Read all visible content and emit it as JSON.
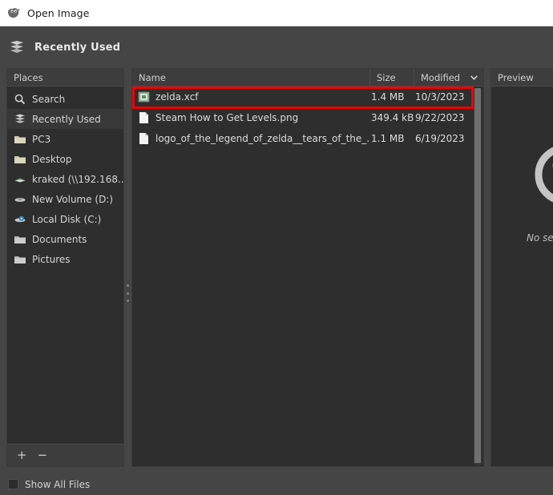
{
  "window": {
    "title": "Open Image",
    "icon": "wilber-icon"
  },
  "location_bar": {
    "icon": "recent-stack-icon",
    "title": "Recently Used"
  },
  "sidebar": {
    "header": "Places",
    "items": [
      {
        "label": "Search",
        "icon": "search-icon",
        "selected": false
      },
      {
        "label": "Recently Used",
        "icon": "recent-stack-icon",
        "selected": true
      },
      {
        "label": "PC3",
        "icon": "folder-icon",
        "selected": false
      },
      {
        "label": "Desktop",
        "icon": "folder-icon",
        "selected": false
      },
      {
        "label": "kraked (\\\\192.168....",
        "icon": "network-drive-icon",
        "selected": false
      },
      {
        "label": "New Volume (D:)",
        "icon": "drive-icon",
        "selected": false
      },
      {
        "label": "Local Disk (C:)",
        "icon": "disk-icon",
        "selected": false
      },
      {
        "label": "Documents",
        "icon": "folder-gray-icon",
        "selected": false
      },
      {
        "label": "Pictures",
        "icon": "folder-gray-icon",
        "selected": false
      }
    ],
    "add_button": "+",
    "remove_button": "−"
  },
  "file_list": {
    "columns": {
      "name": "Name",
      "size": "Size",
      "modified": "Modified",
      "sort_icon": "chevron-down-icon"
    },
    "rows": [
      {
        "name": "zelda.xcf",
        "size": "1.4 MB",
        "modified": "10/3/2023",
        "icon": "xcf-file-icon",
        "highlighted": true
      },
      {
        "name": "Steam How to Get Levels.png",
        "size": "349.4 kB",
        "modified": "9/22/2023",
        "icon": "image-file-icon",
        "highlighted": false
      },
      {
        "name": "logo_of_the_legend_of_zelda__tears_of_the_...",
        "size": "1.1 MB",
        "modified": "6/19/2023",
        "icon": "image-file-icon",
        "highlighted": false
      }
    ]
  },
  "preview": {
    "header": "Preview",
    "icon": "question-mark-icon",
    "empty_text": "No selection"
  },
  "footer": {
    "show_all_files": "Show All Files"
  },
  "annotation": {
    "color": "#ef0000",
    "target": "zelda.xcf"
  },
  "colors": {
    "titlebar_bg": "#ffffff",
    "chrome_bg": "#454545",
    "panel_bg": "#2e2e2e",
    "column_header_bg": "#3d3d3d",
    "selected_row_bg": "#383838",
    "text": "#d6d6d6",
    "annotation_red": "#ef0000"
  }
}
